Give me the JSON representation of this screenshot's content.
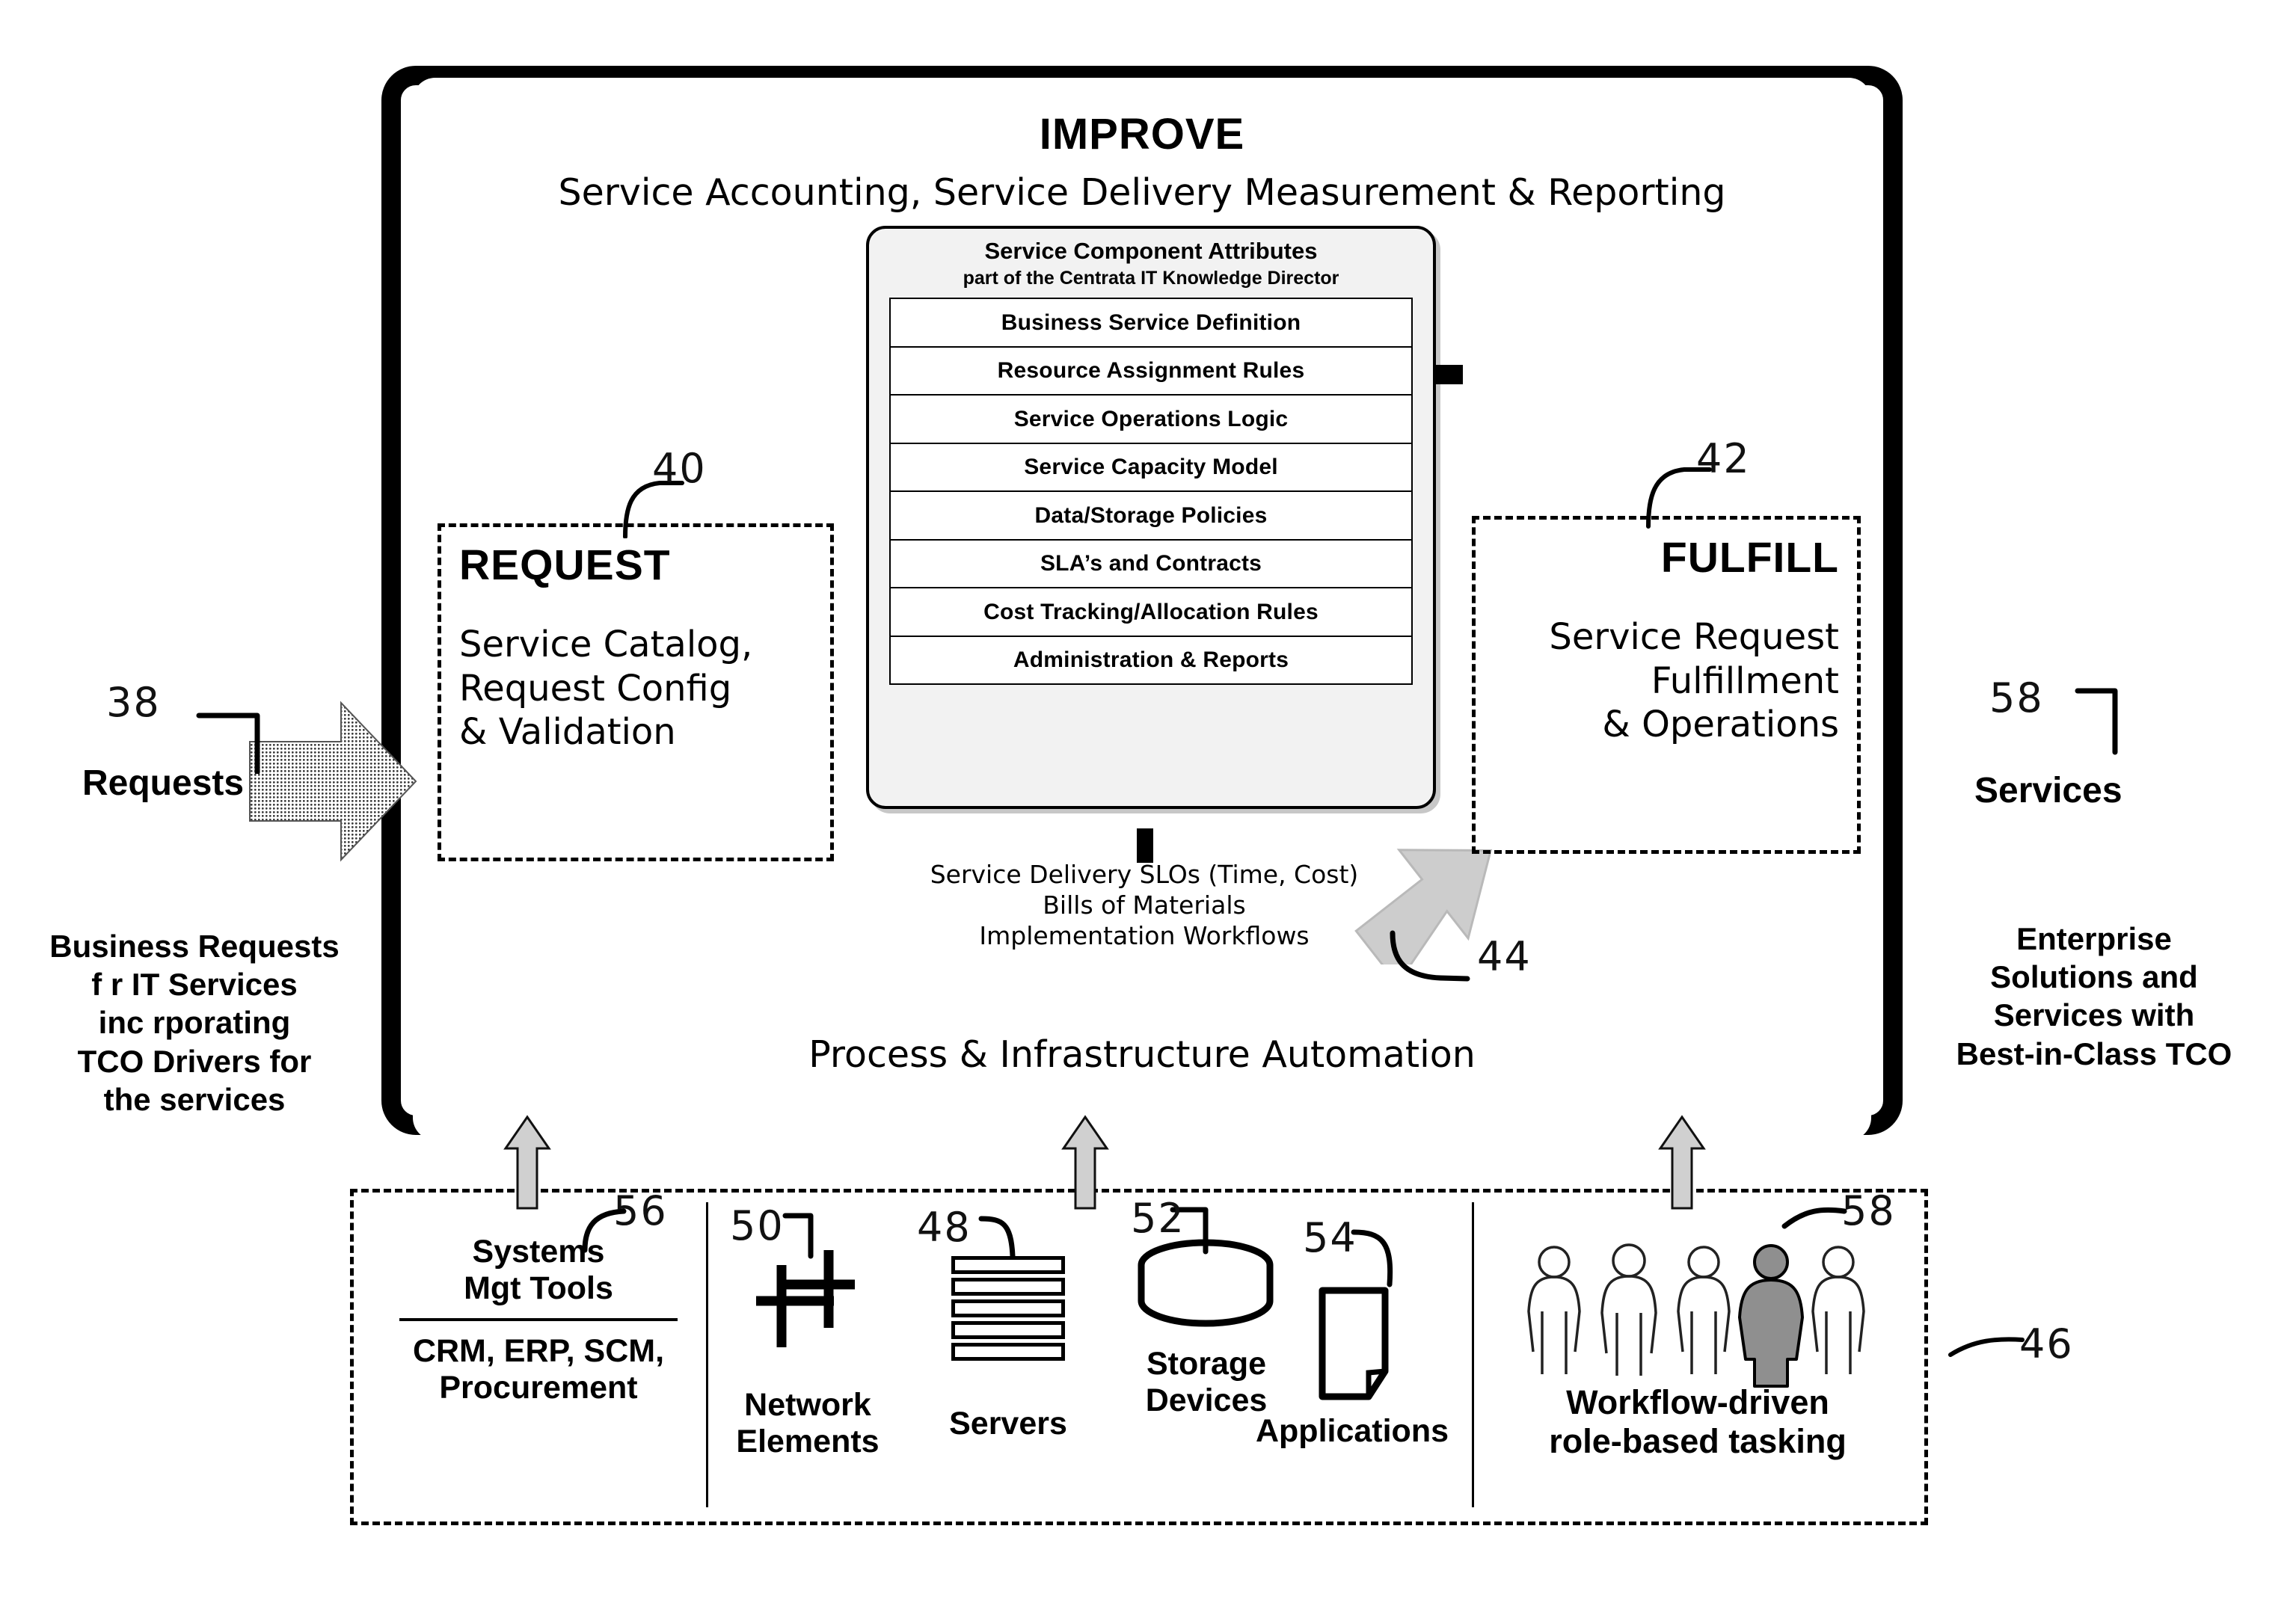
{
  "diagram": {
    "outer_frame": {
      "name": "service-delivery-framework"
    },
    "improve": {
      "title": "IMPROVE",
      "subtitle": "Service Accounting, Service Delivery Measurement & Reporting"
    },
    "automation": {
      "title": "Process & Infrastructure Automation"
    },
    "attributes_card": {
      "title": "Service Component Attributes",
      "subtitle": "part of the Centrata IT Knowledge Director",
      "rows": [
        "Business Service Definition",
        "Resource Assignment Rules",
        "Service Operations Logic",
        "Service Capacity Model",
        "Data/Storage Policies",
        "SLA’s and Contracts",
        "Cost Tracking/Allocation Rules",
        "Administration & Reports"
      ]
    },
    "request_box": {
      "title": "REQUEST",
      "lines": [
        "Service Catalog,",
        "Request Config",
        "& Validation"
      ],
      "ref": "40"
    },
    "fulfill_box": {
      "title": "FULFILL",
      "lines": [
        "Service Request",
        "Fulfillment",
        "& Operations"
      ],
      "ref": "42"
    },
    "slo_block": {
      "lines": [
        "Service Delivery SLOs (Time, Cost)",
        "Bills of Materials",
        "Implementation Workflows"
      ],
      "ref": "44"
    },
    "left_side": {
      "arrow_label": "Requests",
      "ref": "38",
      "caption_lines": [
        "Business Requests",
        "f  r IT Services",
        "inc  rporating",
        "TCO Drivers for",
        "the services"
      ]
    },
    "right_side": {
      "label": "Services",
      "ref": "58",
      "caption_lines": [
        "Enterprise",
        "Solutions and",
        "Services with",
        "Best-in-Class TCO"
      ]
    },
    "infrastructure": {
      "band_ref": "46",
      "cells": [
        {
          "name": "systems-mgt-tools",
          "title_lines": [
            "Systems",
            "Mgt Tools"
          ],
          "sub_lines": [
            "CRM, ERP, SCM,",
            "Procurement"
          ],
          "ref": "56",
          "icon": "none"
        },
        {
          "name": "network-elements",
          "title_lines": [
            "Network",
            "Elements"
          ],
          "sub_lines": [],
          "ref": "50",
          "icon": "network-grid-icon"
        },
        {
          "name": "servers",
          "title_lines": [
            "Servers"
          ],
          "sub_lines": [],
          "ref": "48",
          "icon": "server-stack-icon"
        },
        {
          "name": "storage-devices",
          "title_lines": [
            "Storage",
            "Devices"
          ],
          "sub_lines": [],
          "ref": "52",
          "icon": "storage-cylinder-icon"
        },
        {
          "name": "applications",
          "title_lines": [
            "Applications"
          ],
          "sub_lines": [],
          "ref": "54",
          "icon": "document-page-icon"
        },
        {
          "name": "workflow-role-tasking",
          "title_lines": [
            "Workflow-driven",
            "role-based tasking"
          ],
          "sub_lines": [],
          "ref": "58",
          "icon": "people-group-icon"
        }
      ]
    },
    "colors": {
      "ink": "#000000",
      "paper": "#ffffff",
      "card_fill": "#f2f2f2",
      "arrow_fill": "#b8b8b8"
    }
  }
}
